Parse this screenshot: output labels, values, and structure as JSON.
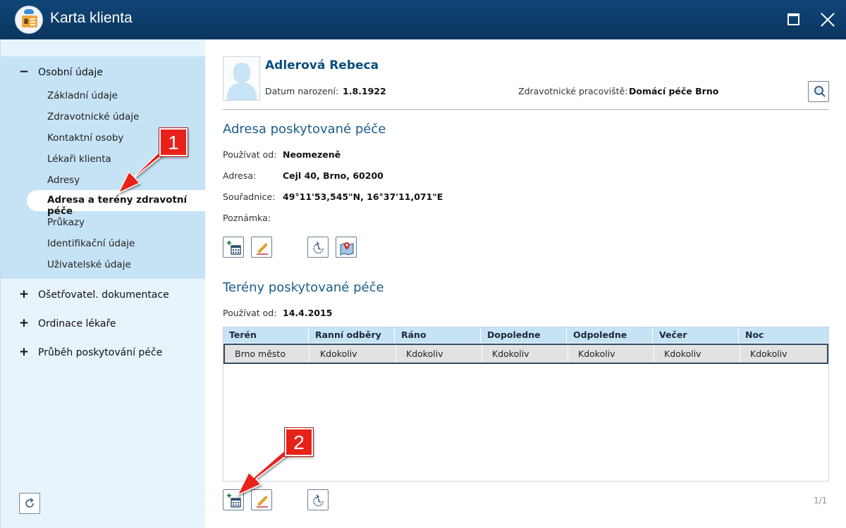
{
  "window": {
    "title": "Karta klienta"
  },
  "sidebar": {
    "sections": [
      {
        "label": "Osobní údaje",
        "sign": "−"
      },
      {
        "label": "Ošetřovatel. dokumentace",
        "sign": "+"
      },
      {
        "label": "Ordinace lékaře",
        "sign": "+"
      },
      {
        "label": "Průběh poskytování péče",
        "sign": "+"
      }
    ],
    "items": [
      "Základní údaje",
      "Zdravotnické údaje",
      "Kontaktní osoby",
      "Lékaři klienta",
      "Adresy",
      "Adresa a terény zdravotní péče",
      "Průkazy",
      "Identifikační údaje",
      "Uživatelské údaje"
    ],
    "active_index": 5
  },
  "client": {
    "name": "Adlerová Rebeca",
    "birth_label": "Datum narození:",
    "birth_value": "1.8.1922",
    "workplace_label": "Zdravotnické pracoviště:",
    "workplace_value": "Domácí péče Brno"
  },
  "address_section": {
    "title": "Adresa poskytované péče",
    "fields": [
      {
        "label": "Používat od:",
        "value": "Neomezeně"
      },
      {
        "label": "Adresa:",
        "value": "Cejl 40, Brno, 60200"
      },
      {
        "label": "Souřadnice:",
        "value": "49°11'53,545\"N, 16°37'11,071\"E"
      },
      {
        "label": "Poznámka:",
        "value": ""
      }
    ]
  },
  "terrain_section": {
    "title": "Terény poskytované péče",
    "use_from_label": "Používat od:",
    "use_from_value": "14.4.2015",
    "columns": [
      "Terén",
      "Ranní odběry",
      "Ráno",
      "Dopoledne",
      "Odpoledne",
      "Večer",
      "Noc"
    ],
    "rows": [
      [
        "Brno město",
        "Kdokoliv",
        "Kdokoliv",
        "Kdokoliv",
        "Kdokoliv",
        "Kdokoliv",
        "Kdokoliv"
      ]
    ],
    "pager": "1/1"
  },
  "annotations": {
    "badge_1": "1",
    "badge_2": "2"
  },
  "icons": {
    "add": "add-calendar-icon",
    "edit": "pencil-icon",
    "history": "history-icon",
    "map": "map-pin-icon",
    "search": "magnifier-icon",
    "refresh": "refresh-icon"
  },
  "colors": {
    "titlebar": "#0e3e6e",
    "accent": "#1c5d8b",
    "sidebar": "#e8f4fc",
    "sidebar_open": "#c6e3f6",
    "badge": "#e8221b"
  }
}
